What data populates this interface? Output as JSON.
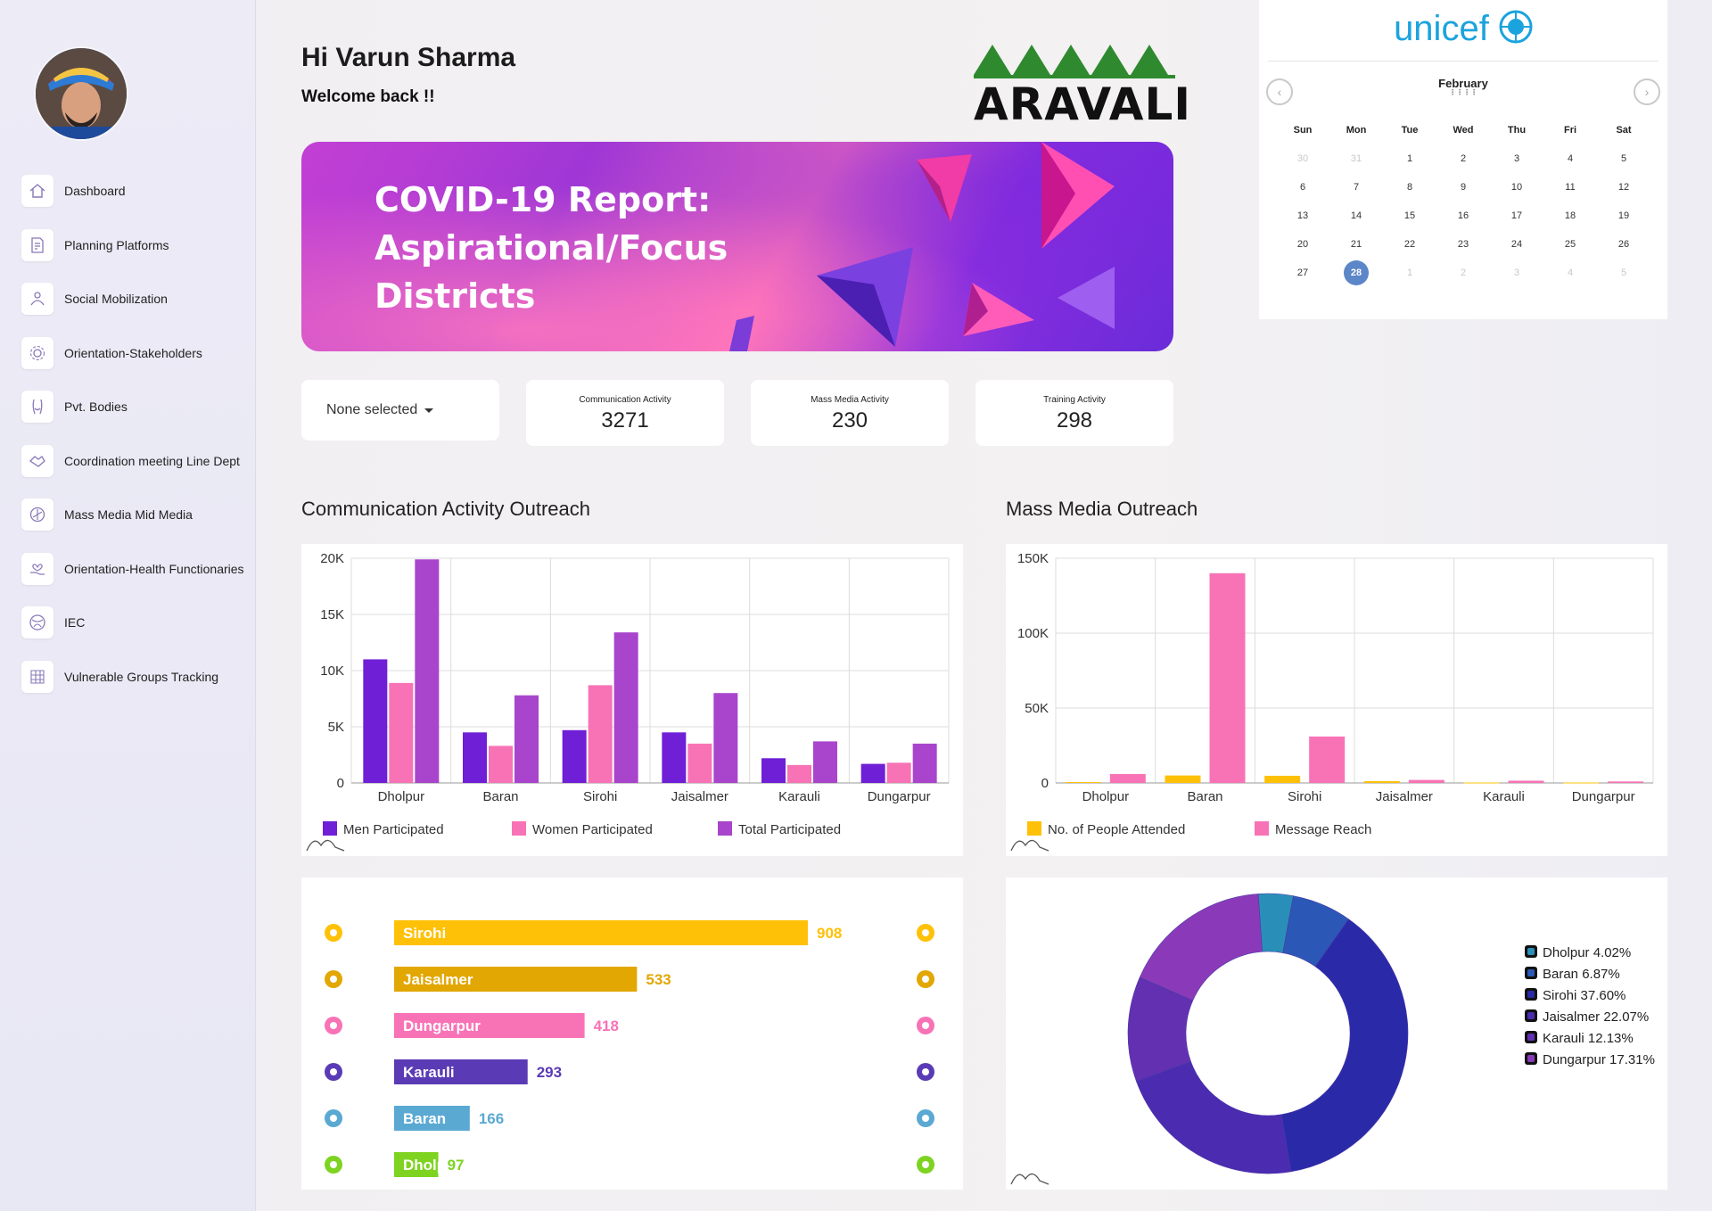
{
  "user": {
    "greeting": "Hi Varun Sharma",
    "welcome": "Welcome back !!"
  },
  "logo": {
    "text": "ARAVALI"
  },
  "partner_logo": {
    "text": "unicef"
  },
  "banner": {
    "line1": "COVID-19 Report:",
    "line2": "Aspirational/Focus",
    "line3": "Districts"
  },
  "sidebar": {
    "items": [
      {
        "label": "Dashboard",
        "icon": "home-icon"
      },
      {
        "label": "Planning Platforms",
        "icon": "document-edit-icon"
      },
      {
        "label": "Social Mobilization",
        "icon": "people-icon"
      },
      {
        "label": "Orientation-Stakeholders",
        "icon": "gear-icon"
      },
      {
        "label": "Pvt. Bodies",
        "icon": "body-icon"
      },
      {
        "label": "Coordination meeting Line Dept",
        "icon": "handshake-icon"
      },
      {
        "label": "Mass Media Mid Media",
        "icon": "broadcast-icon"
      },
      {
        "label": "Orientation-Health Functionaries",
        "icon": "heart-hand-icon"
      },
      {
        "label": "IEC",
        "icon": "globe-icon"
      },
      {
        "label": "Vulnerable Groups Tracking",
        "icon": "grid-icon"
      }
    ]
  },
  "filter": {
    "value": "None selected"
  },
  "stats": [
    {
      "label": "Communication Activity",
      "value": "3271"
    },
    {
      "label": "Mass Media Activity",
      "value": "230"
    },
    {
      "label": "Training Activity",
      "value": "298"
    }
  ],
  "calendar": {
    "month": "February",
    "weekdays": [
      "Sun",
      "Mon",
      "Tue",
      "Wed",
      "Thu",
      "Fri",
      "Sat"
    ],
    "weeks": [
      [
        "30",
        "31",
        "1",
        "2",
        "3",
        "4",
        "5"
      ],
      [
        "6",
        "7",
        "8",
        "9",
        "10",
        "11",
        "12"
      ],
      [
        "13",
        "14",
        "15",
        "16",
        "17",
        "18",
        "19"
      ],
      [
        "20",
        "21",
        "22",
        "23",
        "24",
        "25",
        "26"
      ],
      [
        "27",
        "28",
        "1",
        "2",
        "3",
        "4",
        "5"
      ]
    ],
    "today": "28"
  },
  "sections": {
    "communication_title": "Communication Activity Outreach",
    "mass_media_title": "Mass Media Outreach"
  },
  "chart_data": [
    {
      "type": "bar",
      "title": "Communication Activity Outreach",
      "categories": [
        "Dholpur",
        "Baran",
        "Sirohi",
        "Jaisalmer",
        "Karauli",
        "Dungarpur"
      ],
      "ylim": [
        0,
        20000
      ],
      "yticks": [
        "20K",
        "15K",
        "10K",
        "5K",
        "0"
      ],
      "grid": true,
      "legend_position": "bottom",
      "series": [
        {
          "name": "Men Participated",
          "color": "#6f1fd6",
          "values": [
            11000,
            4500,
            4700,
            4500,
            2200,
            1700
          ]
        },
        {
          "name": "Women Participated",
          "color": "#f873b6",
          "values": [
            8900,
            3300,
            8700,
            3500,
            1600,
            1800
          ]
        },
        {
          "name": "Total Participated",
          "color": "#a845cc",
          "values": [
            19900,
            7800,
            13400,
            8000,
            3700,
            3500
          ]
        }
      ]
    },
    {
      "type": "bar",
      "title": "Mass Media Outreach",
      "categories": [
        "Dholpur",
        "Baran",
        "Sirohi",
        "Jaisalmer",
        "Karauli",
        "Dungarpur"
      ],
      "ylim": [
        0,
        150000
      ],
      "yticks": [
        "150K",
        "100K",
        "50K",
        "0"
      ],
      "grid": true,
      "legend_position": "bottom",
      "series": [
        {
          "name": "No. of People Attended",
          "color": "#ffc107",
          "values": [
            600,
            5000,
            4800,
            1200,
            300,
            300
          ]
        },
        {
          "name": "Message Reach",
          "color": "#f873b6",
          "values": [
            6000,
            140000,
            31000,
            2000,
            1500,
            1000
          ]
        }
      ]
    },
    {
      "type": "bar",
      "orientation": "horizontal",
      "categories": [
        "Sirohi",
        "Jaisalmer",
        "Dungarpur",
        "Karauli",
        "Baran",
        "Dholpur"
      ],
      "values": [
        908,
        533,
        418,
        293,
        166,
        97
      ],
      "labels": [
        "908",
        "533",
        "418",
        "293",
        "166",
        "97"
      ],
      "colors": [
        "#ffc107",
        "#e2a703",
        "#f873b6",
        "#5b3bb5",
        "#5aa9d3",
        "#7ed321"
      ]
    },
    {
      "type": "pie",
      "subtype": "donut",
      "legend_position": "right",
      "slices": [
        {
          "label": "Dholpur 4.02%",
          "value": 4.02,
          "color": "#2a8fb8"
        },
        {
          "label": "Baran 6.87%",
          "value": 6.87,
          "color": "#2b58b6"
        },
        {
          "label": "Sirohi 37.60%",
          "value": 37.6,
          "color": "#2a2aa8"
        },
        {
          "label": "Jaisalmer 22.07%",
          "value": 22.07,
          "color": "#4b2bb0"
        },
        {
          "label": "Karauli 12.13%",
          "value": 12.13,
          "color": "#6330b2"
        },
        {
          "label": "Dungarpur 17.31%",
          "value": 17.31,
          "color": "#8a3ab8"
        }
      ]
    }
  ]
}
